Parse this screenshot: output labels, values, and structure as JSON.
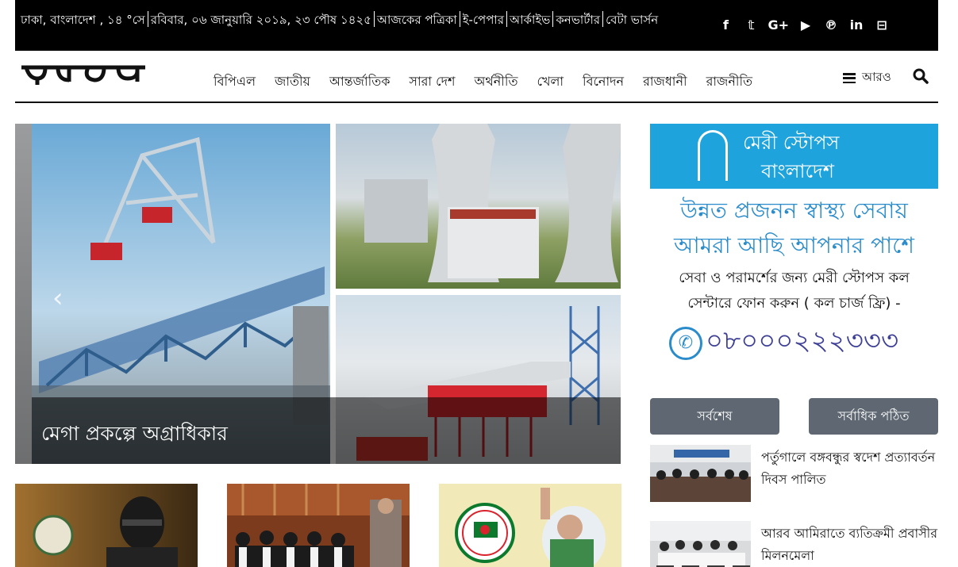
{
  "topbar": {
    "info": [
      "ঢাকা, বাংলাদেশ , ১৪ °সে",
      "রবিবার, ০৬ জানুয়ারি ২০১৯, ২৩ পৌষ ১৪২৫",
      "আজকের পত্রিকা",
      "ই-পেপার",
      "আর্কাইভ",
      "কনভার্টার",
      "বেটা ভার্সন"
    ],
    "social_icons": [
      "facebook-icon",
      "twitter-icon",
      "google-plus-icon",
      "youtube-icon",
      "pinterest-icon",
      "linkedin-icon",
      "rss-icon"
    ],
    "social_glyphs": [
      "f",
      "𝕥",
      "G+",
      "▶",
      "℗",
      "in",
      "⊟"
    ]
  },
  "header": {
    "nav": [
      "বিপিএল",
      "জাতীয়",
      "আন্তর্জাতিক",
      "সারা দেশ",
      "অর্থনীতি",
      "খেলা",
      "বিনোদন",
      "রাজধানী",
      "রাজনীতি"
    ],
    "more_label": "আরও"
  },
  "slider": {
    "caption": "মেগা প্রকল্পে অগ্রাধিকার"
  },
  "ad": {
    "brand_line1": "মেরী স্টোপস",
    "brand_line2": "বাংলাদেশ",
    "line1": "উন্নত প্রজনন স্বাস্থ্য সেবায়",
    "line2": "আমরা আছি আপনার পাশে",
    "line3": "সেবা ও পরামর্শের জন্য মেরী স্টোপস কল",
    "line4": "সেন্টারে ফোন করুন ( কল চার্জ ফ্রি) -",
    "phone": "০৮০০০২২২৩৩৩",
    "brand_color": "#1fa3dc"
  },
  "tabs": [
    "সর্বশেষ",
    "সর্বাধিক পঠিত"
  ],
  "news": [
    {
      "title": "পর্তুগালে বঙ্গবন্ধুর স্বদেশ প্রত্যাবর্তন দিবস পালিত"
    },
    {
      "title": "আরব আমিরাতে ব্যতিক্রমী প্রবাসীর মিলনমেলা"
    }
  ]
}
